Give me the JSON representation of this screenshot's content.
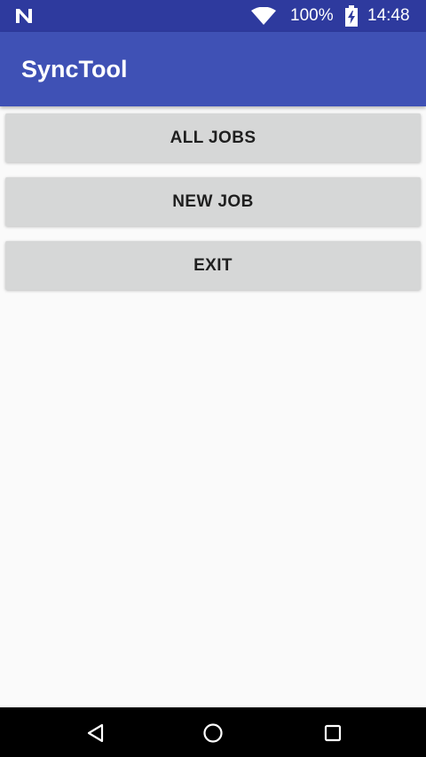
{
  "status_bar": {
    "battery_percent": "100%",
    "time": "14:48",
    "icons": [
      "n-logo-icon",
      "wifi-icon",
      "battery-charging-icon"
    ]
  },
  "app_bar": {
    "title": "SyncTool"
  },
  "menu": {
    "all_jobs_label": "ALL JOBS",
    "new_job_label": "NEW JOB",
    "exit_label": "EXIT"
  },
  "nav_bar": {
    "icons": [
      "back-icon",
      "home-icon",
      "recents-icon"
    ]
  },
  "colors": {
    "status_bar": "#2e3a9e",
    "app_bar": "#3f51b5",
    "button_bg": "#d6d7d7",
    "background": "#fafafa"
  }
}
